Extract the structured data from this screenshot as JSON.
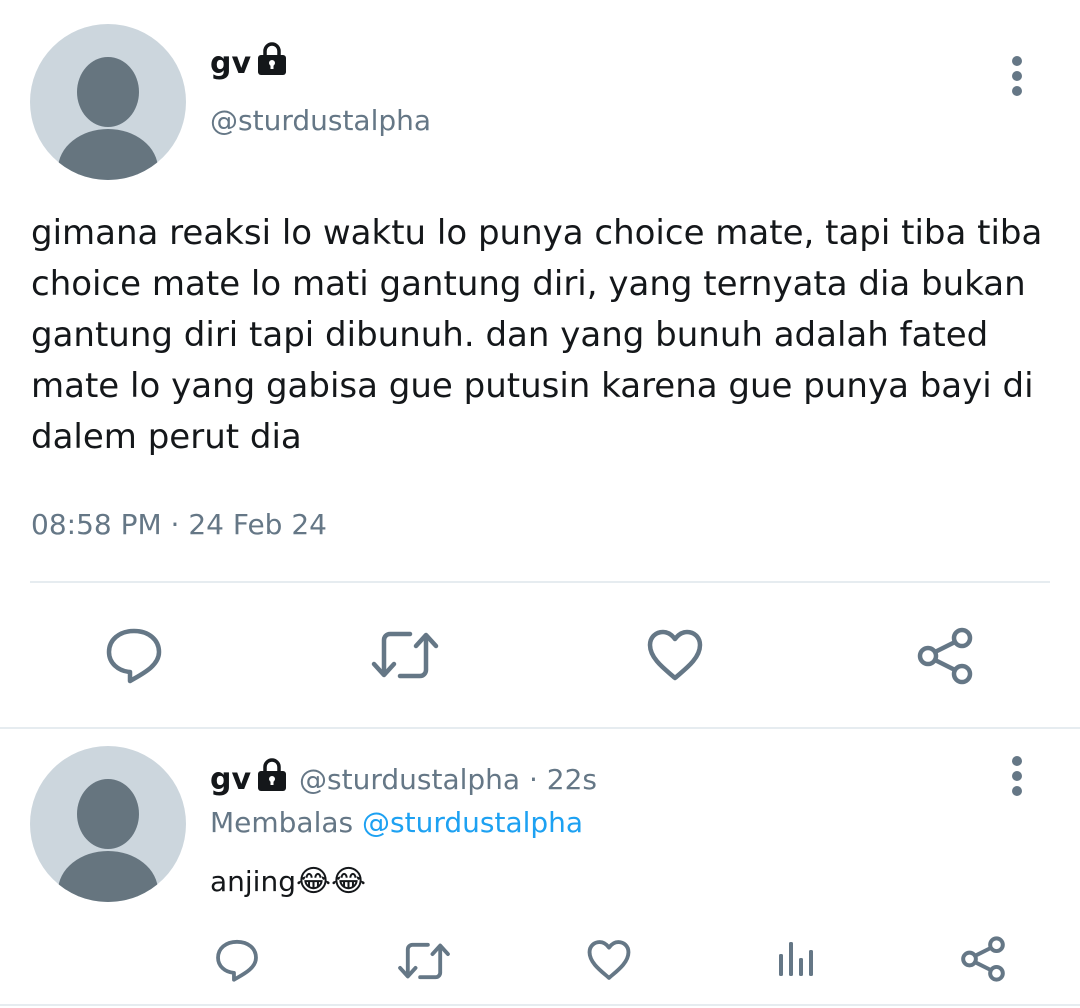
{
  "tweet": {
    "name": "gv",
    "handle": "@sturdustalpha",
    "text_lines": [
      "gimana reaksi lo waktu lo punya choice mate, tapi tiba tiba",
      "choice mate lo mati gantung diri, yang ternyata dia bukan",
      "gantung diri tapi dibunuh. dan yang bunuh adalah fated",
      "mate lo yang gabisa gue putusin karena gue punya bayi di",
      "dalem perut dia"
    ],
    "timestamp": "08:58 PM · 24 Feb 24",
    "actions": [
      "reply-icon",
      "retweet-icon",
      "like-icon",
      "share-icon"
    ]
  },
  "reply": {
    "name": "gv",
    "handle_time": "@sturdustalpha · 22s",
    "replying_prefix": "Membalas",
    "replying_to": "@sturdustalpha",
    "text": "anjing",
    "emojis": "😂😂",
    "actions": [
      "reply-icon",
      "retweet-icon",
      "like-icon",
      "analytics-icon",
      "share-icon"
    ]
  },
  "colors": {
    "primary_text": "#14171a",
    "secondary_text": "#657786",
    "link": "#1da1f2",
    "avatar_bg": "#ccd6dd",
    "avatar_fg": "#66757f",
    "divider": "#e6ecf0"
  }
}
